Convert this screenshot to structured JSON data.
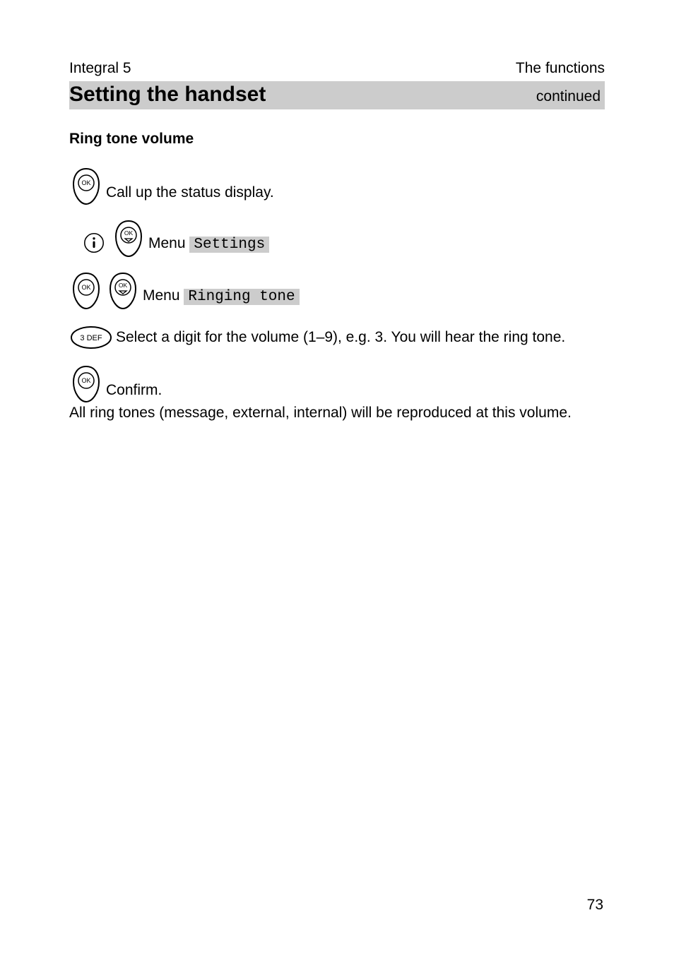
{
  "header": {
    "left": "Integral 5",
    "right": "The functions"
  },
  "title_bar": {
    "title": "Setting the handset",
    "continued": "continued"
  },
  "subheading": "Ring tone volume",
  "steps": {
    "s1": {
      "text": "Call up the status display."
    },
    "s2": {
      "prefix": "Menu ",
      "menu": "Settings"
    },
    "s3": {
      "prefix": "Menu ",
      "menu": "Ringing tone"
    },
    "s4": {
      "text": "Select a digit for the volume (1–9), e.g. 3. You will hear the ring tone."
    },
    "s5": {
      "text": "Confirm."
    }
  },
  "keypad": {
    "key3": "3 DEF"
  },
  "body": "All ring tones (message, external, internal) will be reproduced at this volume.",
  "page_number": "73"
}
